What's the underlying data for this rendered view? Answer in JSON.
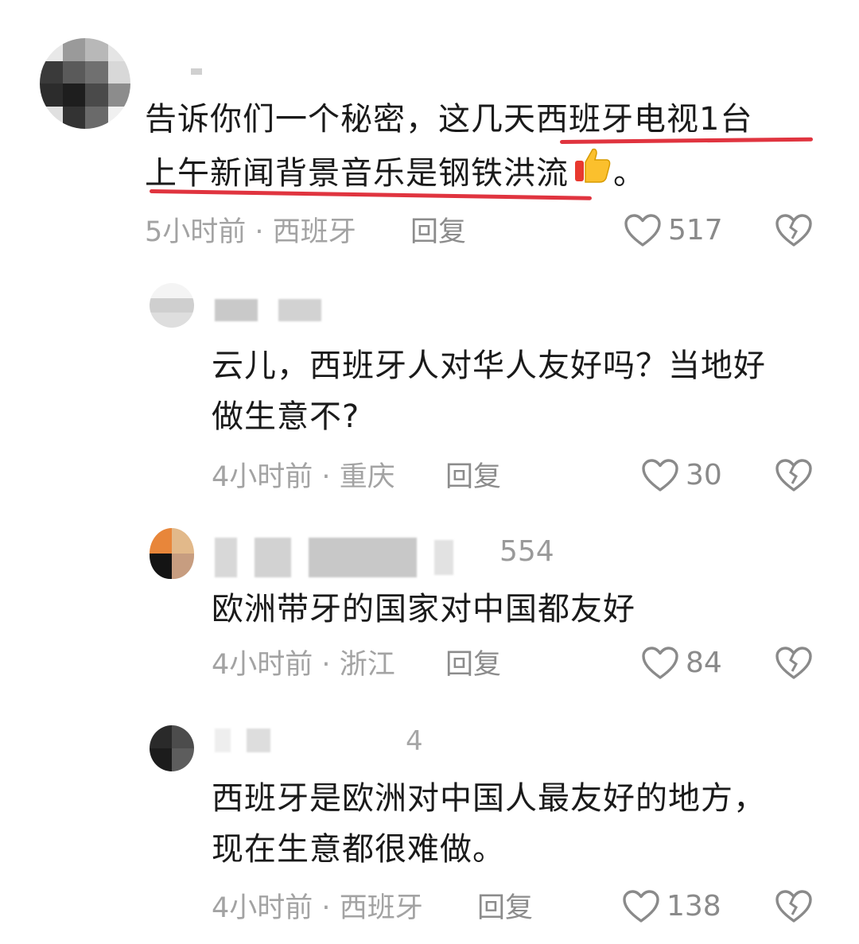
{
  "comments": [
    {
      "text_line1": "告诉你们一个秘密，这几天西班牙电视1台",
      "text_line2": "上午新闻背景音乐是钢铁洪流",
      "text_suffix": "。",
      "emoji": "thumbs-up",
      "time": "5小时前",
      "location": "西班牙",
      "reply_label": "回复",
      "likes": "517"
    },
    {
      "text_line1": "云儿，西班牙人对华人友好吗？当地好",
      "text_line2": "做生意不?",
      "time": "4小时前",
      "location": "重庆",
      "reply_label": "回复",
      "likes": "30"
    },
    {
      "name_fragment": "554",
      "text_line1": "欧洲带牙的国家对中国都友好",
      "time": "4小时前",
      "location": "浙江",
      "reply_label": "回复",
      "likes": "84"
    },
    {
      "name_fragment": "4",
      "text_line1": "西班牙是欧洲对中国人最友好的地方，",
      "text_line2": "现在生意都很难做。",
      "time": "4小时前",
      "location": "西班牙",
      "reply_label": "回复",
      "likes": "138"
    }
  ],
  "separator": "·",
  "colors": {
    "underline": "#e0343f",
    "meta": "#a3a3a3",
    "text": "#1a1a1a"
  },
  "icons": {
    "like": "heart-outline-icon",
    "dislike": "broken-heart-icon"
  }
}
